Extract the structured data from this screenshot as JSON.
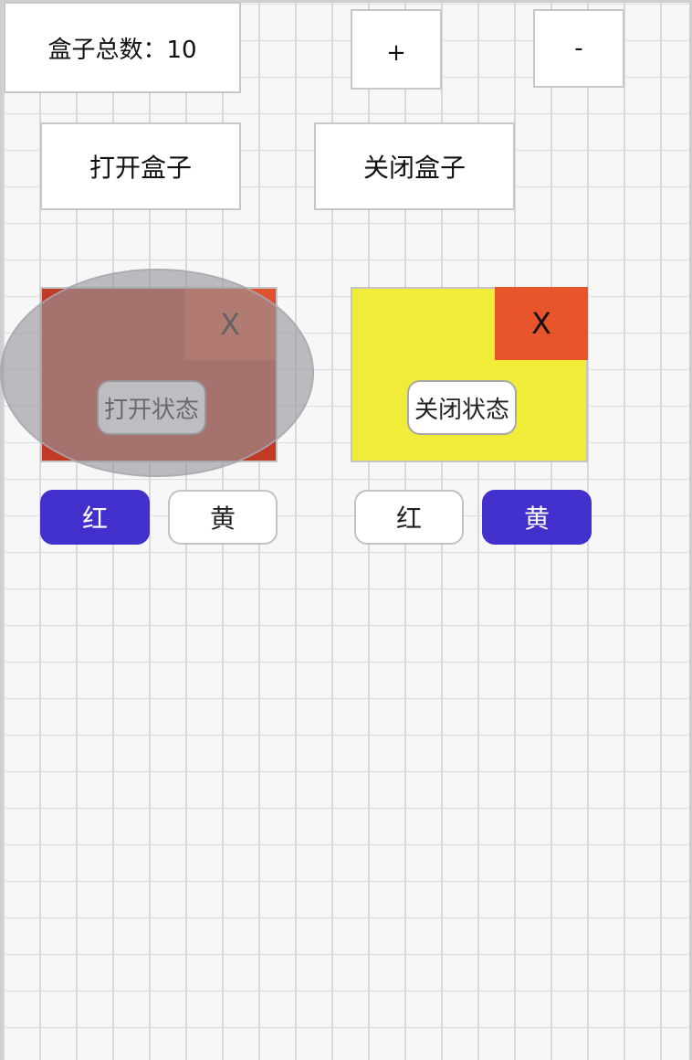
{
  "header": {
    "count_label": "盒子总数：10",
    "plus_label": "+",
    "minus_label": "-"
  },
  "actions": {
    "open_label": "打开盒子",
    "close_label": "关闭盒子"
  },
  "boxes": [
    {
      "close_label": "X",
      "state_label": "打开状态",
      "color": "#c13a23",
      "selected_color": "red",
      "overlay_shown": true,
      "buttons": {
        "red": "红",
        "yellow": "黄"
      }
    },
    {
      "close_label": "X",
      "state_label": "关闭状态",
      "color": "#f0ec37",
      "selected_color": "yellow",
      "overlay_shown": false,
      "buttons": {
        "red": "红",
        "yellow": "黄"
      }
    }
  ],
  "colors": {
    "accent": "#4230cc",
    "red_box": "#c13a23",
    "yellow_box": "#f0ec37",
    "close_corner": "#e8552a"
  }
}
